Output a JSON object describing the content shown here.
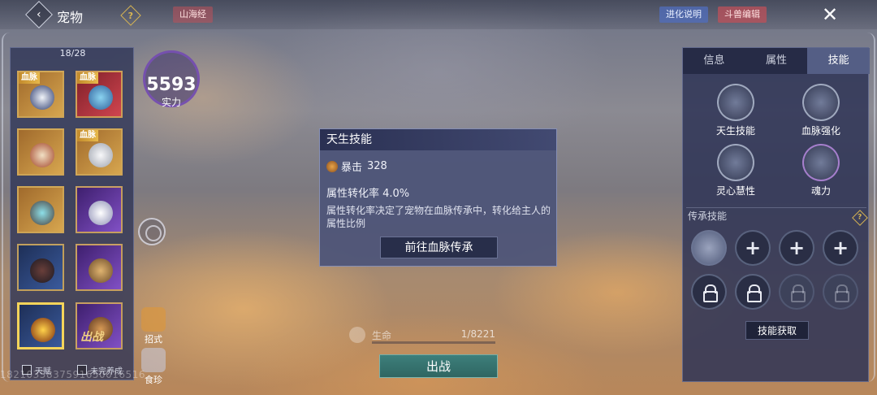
{
  "header": {
    "back_icon": "‹",
    "title": "宠物",
    "help_icon": "?",
    "tag_mountain": "山海经",
    "evolution_label": "进化说明",
    "edit_label": "斗兽编辑",
    "close_icon": "✕"
  },
  "pet_list": {
    "count": "18/28",
    "bloodline_badge": "血脉",
    "deploy_badge": "出战",
    "filter_1": "天赋",
    "filter_2": "未完养成"
  },
  "power": {
    "value": "5593",
    "label": "实力"
  },
  "side_buttons": {
    "moves": "招式",
    "treasure": "食珍"
  },
  "popup": {
    "title": "天生技能",
    "skill_name": "暴击",
    "skill_value": "328",
    "rate_label": "属性转化率 4.0%",
    "description": "属性转化率决定了宠物在血脉传承中，转化给主人的属性比例",
    "goto_label": "前往血脉传承"
  },
  "status": {
    "hp_label": "生命",
    "hp_value": "1/8221",
    "fight_label": "出战"
  },
  "uid": "1821035837591650016516",
  "right_panel": {
    "tabs": [
      {
        "label": "信息"
      },
      {
        "label": "属性"
      },
      {
        "label": "技能"
      }
    ],
    "skills": [
      {
        "label": "天生技能"
      },
      {
        "label": "血脉强化"
      },
      {
        "label": "灵心慧性"
      },
      {
        "label": "魂力"
      }
    ],
    "inherit_title": "传承技能",
    "inherit_help": "?",
    "plus": "+",
    "acquire_label": "技能获取"
  }
}
